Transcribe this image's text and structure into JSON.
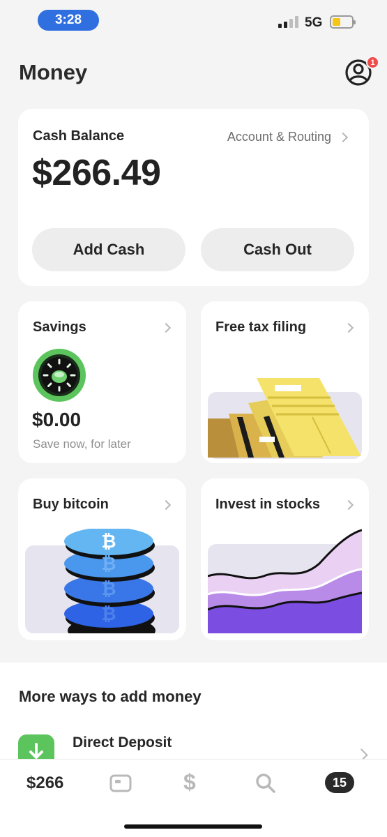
{
  "status_bar": {
    "time": "3:28",
    "network": "5G",
    "battery_percent": 30,
    "signal_bars": 2
  },
  "header": {
    "title": "Money",
    "profile_badge": "1"
  },
  "balance_card": {
    "label": "Cash Balance",
    "account_link": "Account & Routing",
    "amount": "$266.49",
    "add_cash": "Add Cash",
    "cash_out": "Cash Out"
  },
  "tiles": {
    "savings": {
      "title": "Savings",
      "amount": "$0.00",
      "subtitle": "Save now, for later"
    },
    "tax": {
      "title": "Free tax filing"
    },
    "bitcoin": {
      "title": "Buy bitcoin"
    },
    "stocks": {
      "title": "Invest in stocks"
    }
  },
  "more_ways": {
    "title": "More ways to add money",
    "items": [
      {
        "label": "Direct Deposit",
        "icon": "download-icon"
      }
    ]
  },
  "tab_bar": {
    "balance": "$266",
    "activity_count": "15",
    "icons": [
      "card-icon",
      "dollar-icon",
      "search-icon"
    ]
  },
  "colors": {
    "accent_blue": "#2f6fe0",
    "badge_red": "#ef4b4b",
    "savings_green": "#5cc45c",
    "tax_yellow": "#f4e26a",
    "stocks_purple": "#7b4de0",
    "bitcoin_blue": "#3a8fe8"
  }
}
